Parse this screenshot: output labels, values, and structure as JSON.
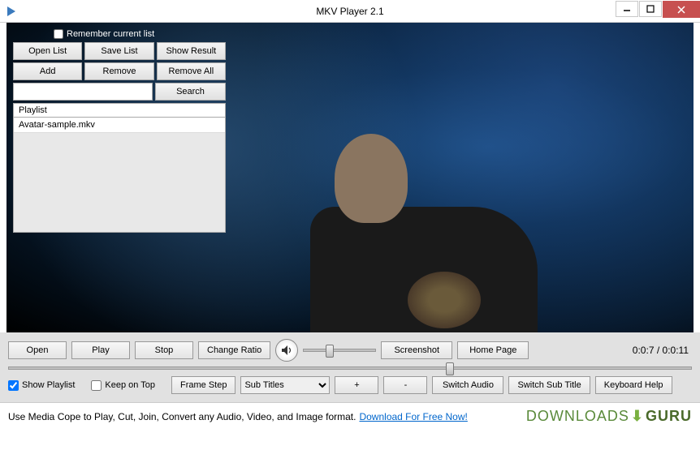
{
  "titlebar": {
    "title": "MKV Player 2.1"
  },
  "playlist": {
    "remember_label": "Remember current list",
    "remember_checked": false,
    "buttons": {
      "open_list": "Open List",
      "save_list": "Save List",
      "show_result": "Show Result",
      "add": "Add",
      "remove": "Remove",
      "remove_all": "Remove All",
      "search": "Search"
    },
    "search_value": "",
    "header": "Playlist",
    "items": [
      "Avatar-sample.mkv"
    ]
  },
  "controls": {
    "row1": {
      "open": "Open",
      "play": "Play",
      "stop": "Stop",
      "change_ratio": "Change Ratio",
      "screenshot": "Screenshot",
      "home_page": "Home Page"
    },
    "volume_percent": 35,
    "time_current": "0:0:7",
    "time_total": "0:0:11",
    "seek_percent": 64,
    "row2": {
      "show_playlist_label": "Show Playlist",
      "show_playlist_checked": true,
      "keep_on_top_label": "Keep on Top",
      "keep_on_top_checked": false,
      "frame_step": "Frame Step",
      "subtitles_selected": "Sub Titles",
      "plus": "+",
      "minus": "-",
      "switch_audio": "Switch Audio",
      "switch_sub_title": "Switch Sub Title",
      "keyboard_help": "Keyboard Help"
    }
  },
  "footer": {
    "text": "Use Media Cope to Play, Cut, Join, Convert any Audio, Video, and Image format.",
    "link": "Download For Free Now!",
    "brand_a": "DOWNLOADS",
    "brand_b": "GURU"
  }
}
